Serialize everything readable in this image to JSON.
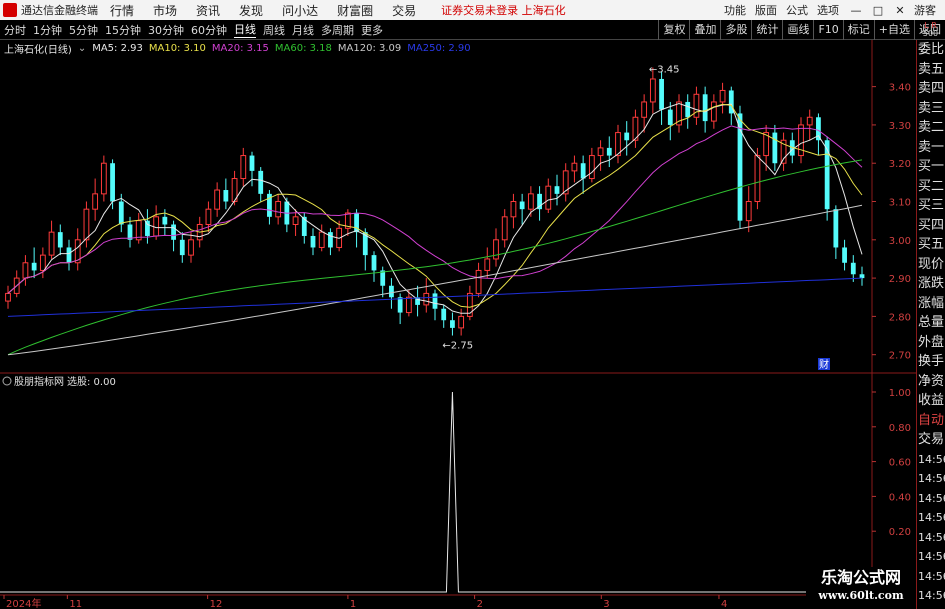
{
  "titlebar": {
    "app_name": "通达信金融终端",
    "menus": [
      "行情",
      "市场",
      "资讯",
      "发现",
      "问小达",
      "财富圈",
      "交易"
    ],
    "notice": "证券交易未登录 上海石化",
    "right_items": [
      "功能",
      "版面",
      "公式",
      "选项"
    ],
    "guest": "游客"
  },
  "toolbar": {
    "periods": [
      "分时",
      "1分钟",
      "5分钟",
      "15分钟",
      "30分钟",
      "60分钟",
      "日线",
      "周线",
      "月线",
      "多周期",
      "更多"
    ],
    "active_period": "日线",
    "right_buttons": [
      "复权",
      "叠加",
      "多股",
      "统计",
      "画线",
      "F10",
      "标记",
      "+自选",
      "返回"
    ]
  },
  "corner": {
    "l": "L",
    "r": "R",
    "num": "500"
  },
  "info": {
    "stock": "上海石化(日线)",
    "ma5": "MA5: 2.93",
    "ma10": "MA10: 3.10",
    "ma20": "MA20: 3.15",
    "ma60": "MA60: 3.18",
    "ma120": "MA120: 3.09",
    "ma250": "MA250: 2.90",
    "colors": {
      "ma5": "#e8e8e8",
      "ma10": "#e8e04a",
      "ma20": "#d040d0",
      "ma60": "#30c030",
      "ma120": "#c8c8c8",
      "ma250": "#2030d8"
    }
  },
  "indicator": {
    "name": "股朋指标网",
    "value_label": "选股: 0.00",
    "yticks": [
      "1.00",
      "0.80",
      "0.60",
      "0.40",
      "0.20"
    ]
  },
  "price_axis": {
    "ticks": [
      "3.40",
      "3.30",
      "3.20",
      "3.10",
      "3.00",
      "2.90",
      "2.80",
      "2.70"
    ]
  },
  "annotations": {
    "high": "3.45",
    "low": "2.75",
    "cai": "财"
  },
  "xaxis": {
    "labels": [
      "2024年",
      "11",
      "12",
      "1",
      "2",
      "3",
      "4"
    ]
  },
  "right_panel": {
    "items": [
      "委比",
      "卖五",
      "卖四",
      "卖三",
      "卖二",
      "卖一",
      "买一",
      "买二",
      "买三",
      "买四",
      "买五",
      "现价",
      "涨跌",
      "涨幅",
      "总量",
      "外盘",
      "换手",
      "净资",
      "收益"
    ],
    "auto": "自动",
    "trade": "交易",
    "times": [
      "14:56",
      "14:56",
      "14:56",
      "14:56",
      "14:56",
      "14:56",
      "14:56",
      "14:56"
    ]
  },
  "watermark": {
    "line1": "乐淘公式网",
    "line2": "www.60lt.com"
  },
  "chart_data": [
    {
      "type": "candlestick",
      "title": "上海石化(日线)",
      "ylim": [
        2.66,
        3.48
      ],
      "candles": [
        [
          2.84,
          2.86,
          2.82,
          2.88
        ],
        [
          2.86,
          2.9,
          2.85,
          2.92
        ],
        [
          2.9,
          2.94,
          2.88,
          2.96
        ],
        [
          2.94,
          2.92,
          2.9,
          2.98
        ],
        [
          2.92,
          2.96,
          2.9,
          2.98
        ],
        [
          2.96,
          3.02,
          2.95,
          3.05
        ],
        [
          3.02,
          2.98,
          2.96,
          3.04
        ],
        [
          2.98,
          2.94,
          2.92,
          3.0
        ],
        [
          2.94,
          3.0,
          2.92,
          3.03
        ],
        [
          3.0,
          3.08,
          2.98,
          3.1
        ],
        [
          3.08,
          3.12,
          3.05,
          3.16
        ],
        [
          3.12,
          3.2,
          3.1,
          3.22
        ],
        [
          3.2,
          3.1,
          3.08,
          3.21
        ],
        [
          3.1,
          3.04,
          3.02,
          3.12
        ],
        [
          3.04,
          3.0,
          2.98,
          3.06
        ],
        [
          3.0,
          3.05,
          2.99,
          3.07
        ],
        [
          3.05,
          3.01,
          2.99,
          3.08
        ],
        [
          3.01,
          3.06,
          3.0,
          3.09
        ],
        [
          3.06,
          3.04,
          3.01,
          3.08
        ],
        [
          3.04,
          3.0,
          2.97,
          3.05
        ],
        [
          3.0,
          2.96,
          2.94,
          3.02
        ],
        [
          2.96,
          3.0,
          2.94,
          3.02
        ],
        [
          3.0,
          3.04,
          2.98,
          3.06
        ],
        [
          3.04,
          3.08,
          3.02,
          3.1
        ],
        [
          3.08,
          3.13,
          3.06,
          3.15
        ],
        [
          3.13,
          3.1,
          3.08,
          3.16
        ],
        [
          3.1,
          3.16,
          3.09,
          3.18
        ],
        [
          3.16,
          3.22,
          3.14,
          3.24
        ],
        [
          3.22,
          3.18,
          3.14,
          3.23
        ],
        [
          3.18,
          3.12,
          3.1,
          3.19
        ],
        [
          3.12,
          3.06,
          3.04,
          3.13
        ],
        [
          3.06,
          3.1,
          3.04,
          3.12
        ],
        [
          3.1,
          3.04,
          3.02,
          3.11
        ],
        [
          3.04,
          3.06,
          3.01,
          3.08
        ],
        [
          3.06,
          3.01,
          2.99,
          3.07
        ],
        [
          3.01,
          2.98,
          2.96,
          3.03
        ],
        [
          2.98,
          3.02,
          2.97,
          3.04
        ],
        [
          3.02,
          2.98,
          2.96,
          3.03
        ],
        [
          2.98,
          3.03,
          2.97,
          3.05
        ],
        [
          3.03,
          3.07,
          3.01,
          3.08
        ],
        [
          3.07,
          3.02,
          2.98,
          3.08
        ],
        [
          3.02,
          2.96,
          2.92,
          3.03
        ],
        [
          2.96,
          2.92,
          2.89,
          2.97
        ],
        [
          2.92,
          2.88,
          2.85,
          2.93
        ],
        [
          2.88,
          2.85,
          2.82,
          2.9
        ],
        [
          2.85,
          2.81,
          2.78,
          2.86
        ],
        [
          2.81,
          2.85,
          2.8,
          2.87
        ],
        [
          2.85,
          2.83,
          2.8,
          2.88
        ],
        [
          2.83,
          2.86,
          2.81,
          2.9
        ],
        [
          2.86,
          2.82,
          2.79,
          2.87
        ],
        [
          2.82,
          2.79,
          2.77,
          2.83
        ],
        [
          2.79,
          2.77,
          2.75,
          2.81
        ],
        [
          2.77,
          2.8,
          2.75,
          2.82
        ],
        [
          2.8,
          2.86,
          2.79,
          2.88
        ],
        [
          2.86,
          2.92,
          2.85,
          2.94
        ],
        [
          2.92,
          2.95,
          2.9,
          2.98
        ],
        [
          2.95,
          3.0,
          2.93,
          3.03
        ],
        [
          3.0,
          3.06,
          2.98,
          3.08
        ],
        [
          3.06,
          3.1,
          3.03,
          3.12
        ],
        [
          3.1,
          3.08,
          3.04,
          3.12
        ],
        [
          3.08,
          3.12,
          3.06,
          3.14
        ],
        [
          3.12,
          3.08,
          3.05,
          3.14
        ],
        [
          3.08,
          3.14,
          3.07,
          3.16
        ],
        [
          3.14,
          3.12,
          3.09,
          3.17
        ],
        [
          3.12,
          3.18,
          3.1,
          3.2
        ],
        [
          3.18,
          3.2,
          3.15,
          3.22
        ],
        [
          3.2,
          3.16,
          3.12,
          3.22
        ],
        [
          3.16,
          3.22,
          3.15,
          3.24
        ],
        [
          3.22,
          3.24,
          3.18,
          3.26
        ],
        [
          3.24,
          3.22,
          3.19,
          3.27
        ],
        [
          3.22,
          3.28,
          3.2,
          3.3
        ],
        [
          3.28,
          3.26,
          3.22,
          3.31
        ],
        [
          3.26,
          3.32,
          3.24,
          3.34
        ],
        [
          3.32,
          3.36,
          3.28,
          3.38
        ],
        [
          3.36,
          3.42,
          3.33,
          3.45
        ],
        [
          3.42,
          3.34,
          3.3,
          3.44
        ],
        [
          3.34,
          3.3,
          3.26,
          3.36
        ],
        [
          3.3,
          3.36,
          3.28,
          3.38
        ],
        [
          3.36,
          3.32,
          3.29,
          3.38
        ],
        [
          3.32,
          3.38,
          3.3,
          3.4
        ],
        [
          3.38,
          3.31,
          3.28,
          3.4
        ],
        [
          3.31,
          3.36,
          3.29,
          3.38
        ],
        [
          3.36,
          3.39,
          3.33,
          3.41
        ],
        [
          3.39,
          3.33,
          3.3,
          3.4
        ],
        [
          3.33,
          3.05,
          3.03,
          3.35
        ],
        [
          3.05,
          3.1,
          3.02,
          3.14
        ],
        [
          3.1,
          3.22,
          3.08,
          3.24
        ],
        [
          3.22,
          3.28,
          3.18,
          3.3
        ],
        [
          3.28,
          3.2,
          3.18,
          3.3
        ],
        [
          3.2,
          3.26,
          3.18,
          3.28
        ],
        [
          3.26,
          3.22,
          3.2,
          3.28
        ],
        [
          3.22,
          3.3,
          3.2,
          3.32
        ],
        [
          3.3,
          3.32,
          3.26,
          3.34
        ],
        [
          3.32,
          3.26,
          3.22,
          3.33
        ],
        [
          3.26,
          3.08,
          3.05,
          3.27
        ],
        [
          3.08,
          2.98,
          2.95,
          3.09
        ],
        [
          2.98,
          2.94,
          2.92,
          3.0
        ],
        [
          2.94,
          2.91,
          2.89,
          2.96
        ],
        [
          2.91,
          2.9,
          2.88,
          2.93
        ]
      ]
    },
    {
      "type": "line",
      "title": "股朋指标网",
      "ylim": [
        0,
        1.05
      ],
      "series": [
        {
          "name": "选股",
          "values": "zeros with a single spike to 1.00 at bar 51"
        }
      ],
      "spike_index": 51
    }
  ]
}
